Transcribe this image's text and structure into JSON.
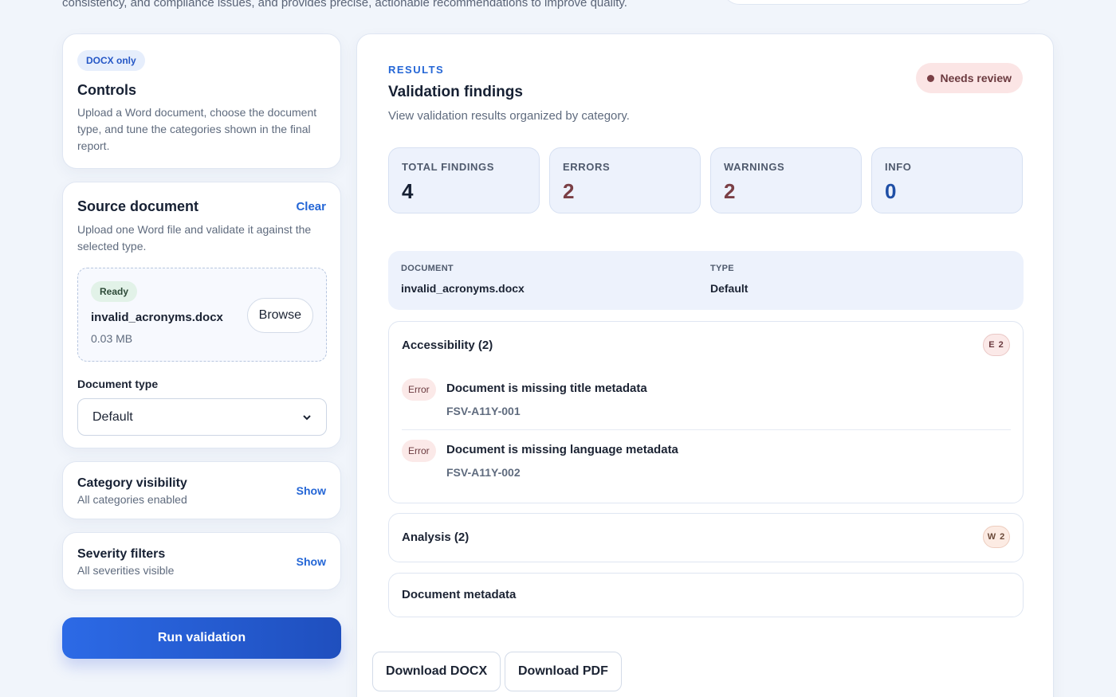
{
  "intro_text": "consistency, and compliance issues, and provides precise, actionable recommendations to improve quality.",
  "controls": {
    "badge": "DOCX only",
    "title": "Controls",
    "description": "Upload a Word document, choose the document type, and tune the categories shown in the final report."
  },
  "source": {
    "title": "Source document",
    "clear_label": "Clear",
    "description": "Upload one Word file and validate it against the selected type.",
    "file_status": "Ready",
    "file_name": "invalid_acronyms.docx",
    "file_size": "0.03 MB",
    "browse_label": "Browse",
    "doc_type_label": "Document type",
    "doc_type_value": "Default"
  },
  "category_visibility": {
    "title": "Category visibility",
    "subtitle": "All categories enabled",
    "action": "Show"
  },
  "severity_filters": {
    "title": "Severity filters",
    "subtitle": "All severities visible",
    "action": "Show"
  },
  "run_label": "Run validation",
  "results": {
    "eyebrow": "RESULTS",
    "title": "Validation findings",
    "subtitle": "View validation results organized by category.",
    "status": "Needs review",
    "stats": [
      {
        "label": "TOTAL FINDINGS",
        "value": "4",
        "color": "#162033"
      },
      {
        "label": "ERRORS",
        "value": "2",
        "color": "#7a3f45"
      },
      {
        "label": "WARNINGS",
        "value": "2",
        "color": "#7a3f45"
      },
      {
        "label": "INFO",
        "value": "0",
        "color": "#1f4fa6"
      }
    ],
    "doc_info": {
      "document_label": "DOCUMENT",
      "document_value": "invalid_acronyms.docx",
      "type_label": "TYPE",
      "type_value": "Default"
    },
    "groups": [
      {
        "title": "Accessibility (2)",
        "badge": "E 2",
        "findings": [
          {
            "severity": "Error",
            "title": "Document is missing title metadata",
            "code": "FSV-A11Y-001"
          },
          {
            "severity": "Error",
            "title": "Document is missing language metadata",
            "code": "FSV-A11Y-002"
          }
        ]
      },
      {
        "title": "Analysis (2)",
        "badge": "W 2"
      },
      {
        "title": "Document metadata"
      }
    ],
    "download_docx": "Download DOCX",
    "download_pdf": "Download PDF"
  },
  "colors": {
    "accent": "#2466d6",
    "error": "#7a3f45",
    "info": "#1f4fa6"
  }
}
